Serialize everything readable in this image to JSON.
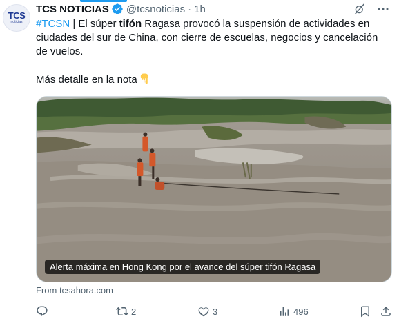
{
  "tweet": {
    "avatar": {
      "logo_text": "TCS",
      "logo_sub": "noticias"
    },
    "author_name": "TCS NOTICIAS",
    "handle": "@tcsnoticias",
    "separator": "·",
    "time": "1h",
    "body": {
      "hashtag": "#TCSN",
      "pipe": " | El súper ",
      "bold_word": "tifón",
      "rest": " Ragasa provocó la suspensión de actividades en ciudades del sur de China, con cierre de escuelas, negocios y cancelación de vuelos.",
      "more_line": "Más detalle en la nota"
    },
    "media": {
      "caption": "Alerta máxima en Hong Kong por el avance del súper tifón Ragasa"
    },
    "source": "From tcsahora.com",
    "actions": {
      "reply_count": "",
      "retweet_count": "2",
      "like_count": "3",
      "views_count": "496"
    }
  },
  "icons": [
    "verified-badge-icon",
    "grok-icon",
    "more-options-icon",
    "pointing-down-emoji",
    "reply-icon",
    "retweet-icon",
    "like-icon",
    "views-icon",
    "bookmark-icon",
    "share-icon"
  ],
  "colors": {
    "accent": "#1d9bf0",
    "text": "#0f1419",
    "secondary": "#536471"
  }
}
